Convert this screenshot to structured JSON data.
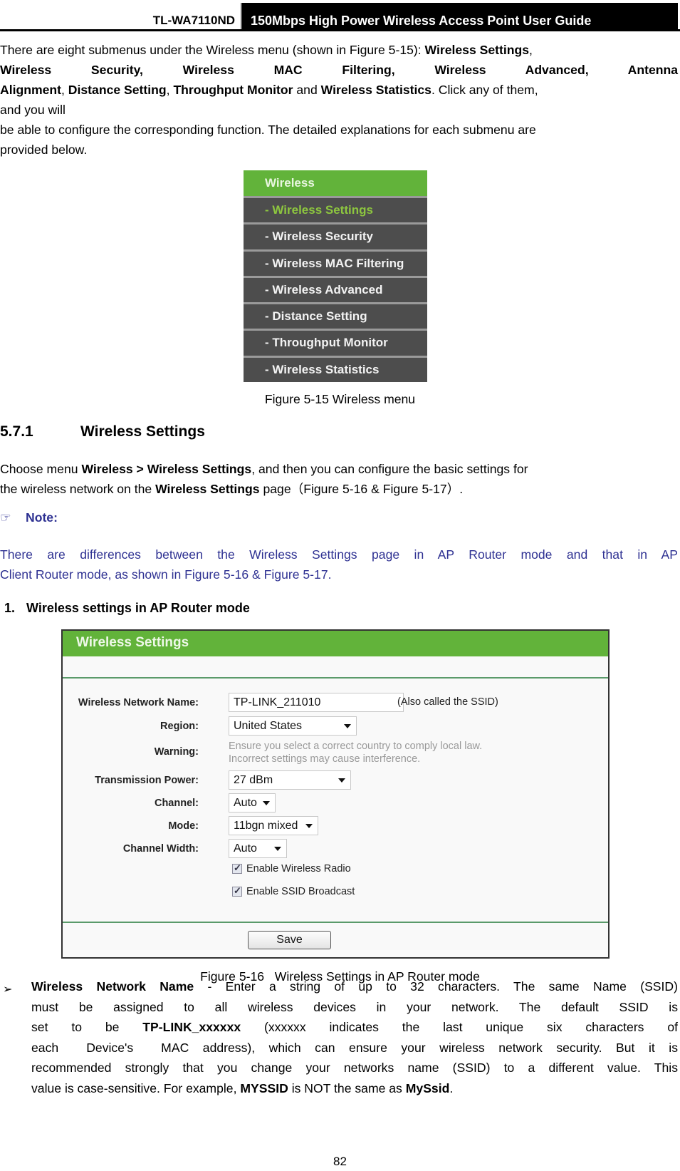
{
  "header": {
    "model": "TL-WA7110ND",
    "guide_title": "150Mbps High Power Wireless Access Point User Guide"
  },
  "intro": {
    "line1_pre": "There are eight submenus under the Wireless menu (shown in Figure 5-15): ",
    "line1_b1": "Wireless Settings",
    "line1_post": ",",
    "line2": [
      "Wireless",
      "Security,",
      "Wireless",
      "MAC",
      "Filtering,",
      "Wireless",
      "Advanced,",
      "Antenna"
    ],
    "line3_b1": "Alignment",
    "line3_s1": ", ",
    "line3_b2": "Distance Setting",
    "line3_s2": ", ",
    "line3_b3": "Throughput Monitor",
    "line3_s3": " and ",
    "line3_b4": "Wireless Statistics",
    "line3_s4": ". Click any of them,",
    "line4": "and you will",
    "line5": "be able to configure the corresponding function. The detailed explanations for each submenu are",
    "line6": "provided below."
  },
  "wireless_menu": {
    "header": "Wireless",
    "items": [
      {
        "label": "- Wireless Settings",
        "active": true
      },
      {
        "label": "- Wireless Security",
        "active": false
      },
      {
        "label": "- Wireless MAC Filtering",
        "active": false
      },
      {
        "label": "- Wireless Advanced",
        "active": false
      },
      {
        "label": "- Distance Setting",
        "active": false
      },
      {
        "label": "- Throughput Monitor",
        "active": false
      },
      {
        "label": "- Wireless Statistics",
        "active": false
      }
    ],
    "caption": "Figure 5-15 Wireless menu"
  },
  "section": {
    "number": "5.7.1",
    "title": "Wireless Settings",
    "p1_pre": "Choose menu ",
    "p1_b1": "Wireless > Wireless Settings",
    "p1_mid": ", and then you can configure the basic settings for",
    "p2_pre": "the wireless network on the ",
    "p2_b1": "Wireless Settings",
    "p2_post": " page（Figure 5-16 & Figure 5-17）."
  },
  "note": {
    "icon": "pointing-hand-icon",
    "label": "Note:",
    "line1": "There are differences between the Wireless Settings page in AP Router mode and that in AP",
    "line2": "Client Router mode, as shown in Figure 5-16 & Figure 5-17."
  },
  "subsection": {
    "number": "1.",
    "title": "Wireless settings in AP Router mode"
  },
  "wireless_settings_form": {
    "title": "Wireless Settings",
    "fields": {
      "network_name": {
        "label": "Wireless Network Name:",
        "value": "TP-LINK_211010",
        "hint": "(Also called the SSID)"
      },
      "region": {
        "label": "Region:",
        "value": "United States"
      },
      "warning": {
        "label": "Warning:",
        "line1": "Ensure you select a correct country to comply local law.",
        "line2": "Incorrect settings may cause interference."
      },
      "transmission_power": {
        "label": "Transmission Power:",
        "value": "27 dBm"
      },
      "channel": {
        "label": "Channel:",
        "value": "Auto"
      },
      "mode": {
        "label": "Mode:",
        "value": "11bgn mixed"
      },
      "channel_width": {
        "label": "Channel Width:",
        "value": "Auto"
      }
    },
    "checkboxes": [
      {
        "label": "Enable Wireless Radio",
        "checked": true
      },
      {
        "label": "Enable SSID Broadcast",
        "checked": true
      }
    ],
    "save_label": "Save",
    "caption": "Figure 5-16   Wireless Settings in AP Router mode"
  },
  "bullet": {
    "marker": "➢",
    "l1_b": "Wireless Network Name",
    "l1_t": " - Enter a string of up to 32 characters. The same Name (SSID)",
    "l2": "must be assigned to all wireless devices in your network. The default SSID is",
    "l3_pre": "set to be ",
    "l3_b": "TP-LINK_xxxxxx",
    "l3_post": " (xxxxxx indicates the last unique six characters of",
    "l4": "each  Device's  MAC address), which can ensure your wireless network security. But it is",
    "l5": "recommended strongly that you change your networks name (SSID) to a different value. This",
    "l6_pre": "value is case-sensitive. For example, ",
    "l6_b1": "MYSSID",
    "l6_mid": " is NOT the same as ",
    "l6_b2": "MySsid",
    "l6_post": "."
  },
  "page_number": "82"
}
